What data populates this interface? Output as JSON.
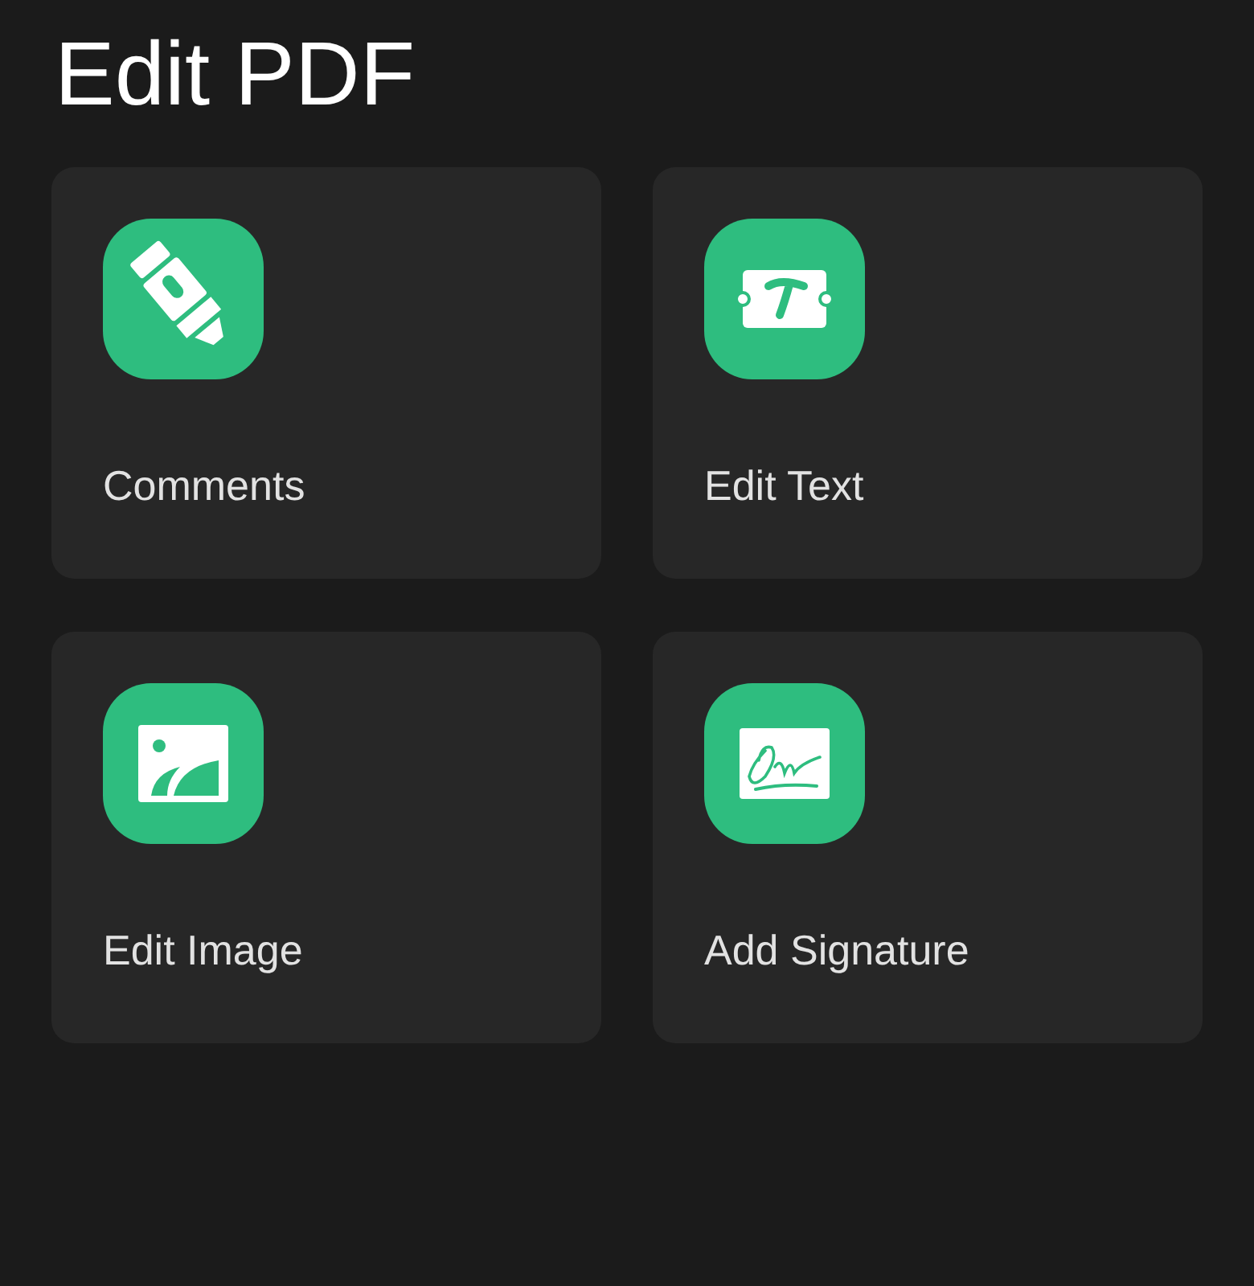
{
  "title": "Edit PDF",
  "tools": [
    {
      "label": "Comments",
      "kind": "highlighter"
    },
    {
      "label": "Edit Text",
      "kind": "text"
    },
    {
      "label": "Edit Image",
      "kind": "image"
    },
    {
      "label": "Add Signature",
      "kind": "signature"
    }
  ]
}
